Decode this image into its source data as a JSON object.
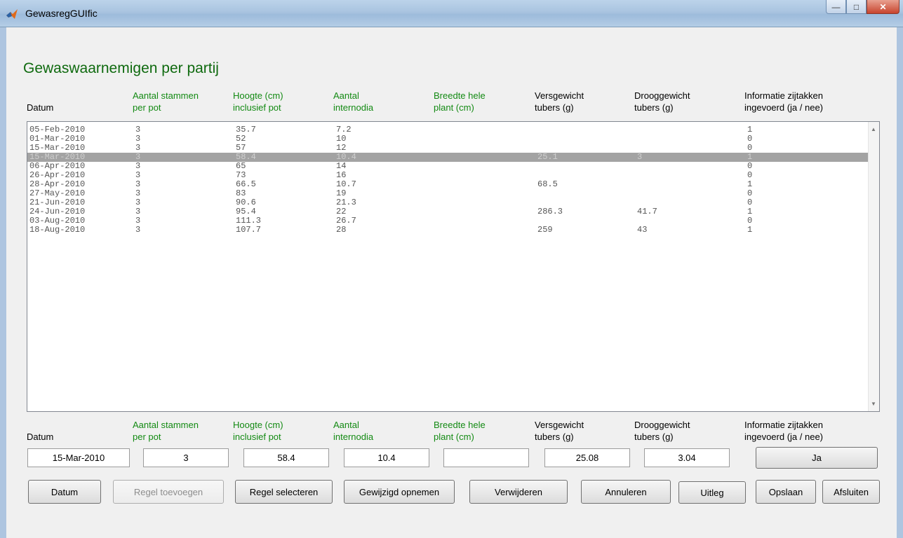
{
  "window": {
    "title": "GewasregGUIfic"
  },
  "heading": "Gewaswaarnemigen per partij",
  "columns": [
    {
      "l1": "",
      "l2": "Datum"
    },
    {
      "l1": "Aantal stammen",
      "l2": "per pot"
    },
    {
      "l1": "Hoogte (cm)",
      "l2": "inclusief pot"
    },
    {
      "l1": "Aantal",
      "l2": "internodia"
    },
    {
      "l1": "Breedte hele",
      "l2": "plant (cm)"
    },
    {
      "l1": "Versgewicht",
      "l2": "tubers (g)"
    },
    {
      "l1": "Drooggewicht",
      "l2": "tubers (g)"
    },
    {
      "l1": "Informatie zijtakken",
      "l2": "ingevoerd (ja / nee)"
    }
  ],
  "rows": [
    [
      "05-Feb-2010",
      "3",
      "35.7",
      "7.2",
      "",
      "",
      "",
      "1"
    ],
    [
      "01-Mar-2010",
      "3",
      "52",
      "10",
      "",
      "",
      "",
      "0"
    ],
    [
      "15-Mar-2010",
      "3",
      "57",
      "12",
      "",
      "",
      "",
      "0"
    ],
    [
      "15-Mar-2010",
      "3",
      "58.4",
      "10.4",
      "",
      "25.1",
      "3",
      "1"
    ],
    [
      "06-Apr-2010",
      "3",
      "65",
      "14",
      "",
      "",
      "",
      "0"
    ],
    [
      "26-Apr-2010",
      "3",
      "73",
      "16",
      "",
      "",
      "",
      "0"
    ],
    [
      "28-Apr-2010",
      "3",
      "66.5",
      "10.7",
      "",
      "68.5",
      "",
      "1"
    ],
    [
      "27-May-2010",
      "3",
      "83",
      "19",
      "",
      "",
      "",
      "0"
    ],
    [
      "21-Jun-2010",
      "3",
      "90.6",
      "21.3",
      "",
      "",
      "",
      "0"
    ],
    [
      "24-Jun-2010",
      "3",
      "95.4",
      "22",
      "",
      "286.3",
      "41.7",
      "1"
    ],
    [
      "03-Aug-2010",
      "3",
      "111.3",
      "26.7",
      "",
      "",
      "",
      "0"
    ],
    [
      "18-Aug-2010",
      "3",
      "107.7",
      "28",
      "",
      "259",
      "43",
      "1"
    ]
  ],
  "selected_row": 3,
  "inputs": {
    "datum": "15-Mar-2010",
    "stammen": "3",
    "hoogte": "58.4",
    "internodia": "10.4",
    "breedte": "",
    "versgewicht": "25.08",
    "drooggewicht": "3.04",
    "zijtakken": "Ja"
  },
  "buttons": {
    "datum": "Datum",
    "regel_toevoegen": "Regel toevoegen",
    "regel_selecteren": "Regel selecteren",
    "gewijzigd_opnemen": "Gewijzigd opnemen",
    "verwijderen": "Verwijderen",
    "annuleren": "Annuleren",
    "uitleg": "Uitleg",
    "opslaan": "Opslaan",
    "afsluiten": "Afsluiten"
  },
  "colors": {
    "header_green": "#138a13",
    "selection": "#a3a3a3"
  },
  "icons": {
    "app": "matlab-logo-icon",
    "scroll_up": "scroll-up-icon",
    "scroll_down": "scroll-down-icon"
  }
}
